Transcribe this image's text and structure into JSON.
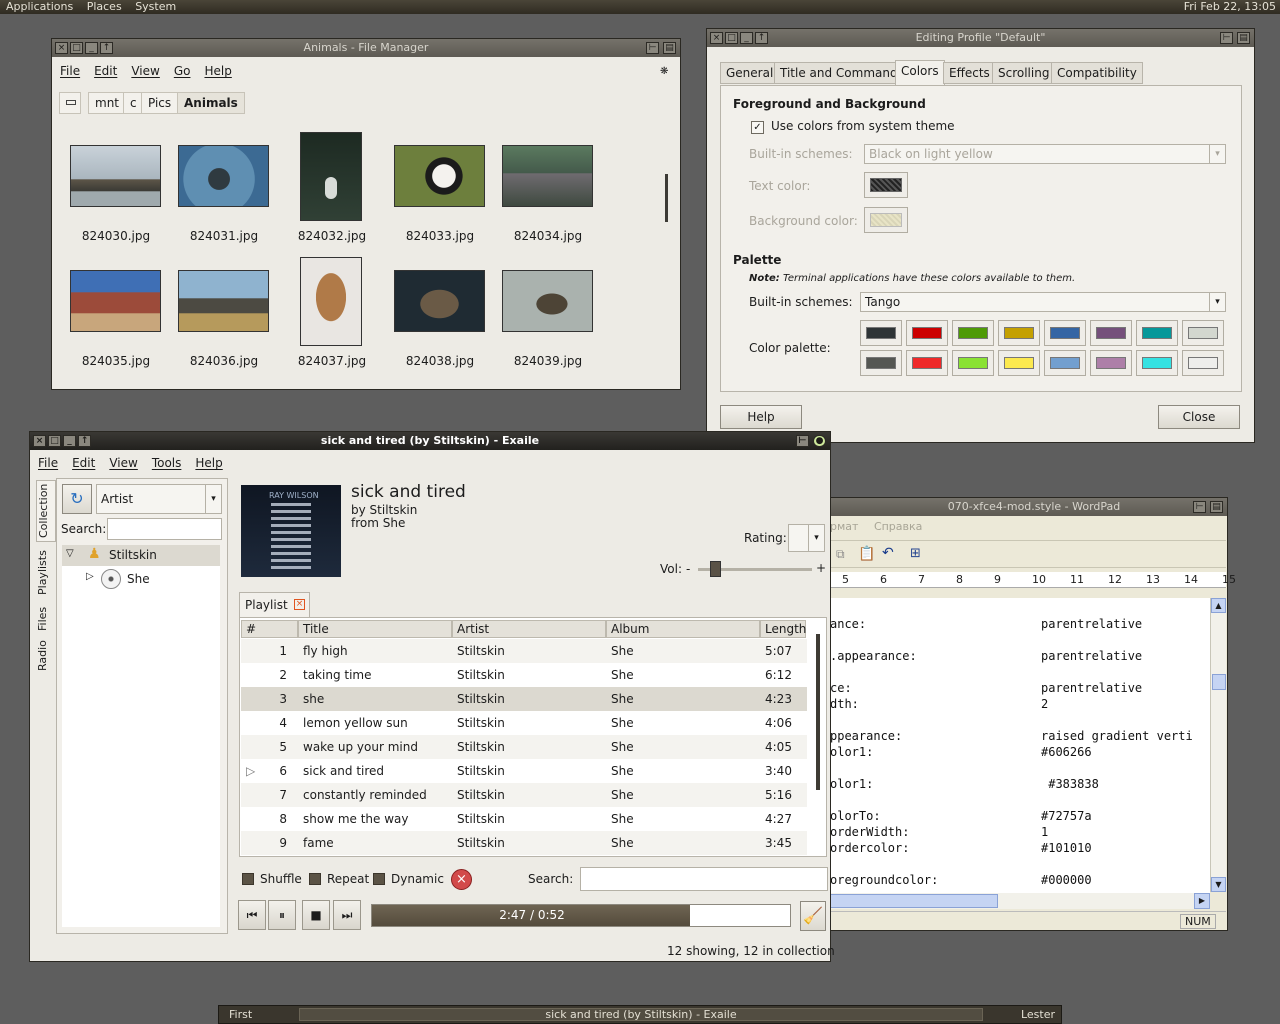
{
  "topbar": {
    "menus": [
      "Applications",
      "Places",
      "System"
    ],
    "clock": "Fri Feb 22, 13:05"
  },
  "file_manager": {
    "title": "Animals - File Manager",
    "menus": [
      "File",
      "Edit",
      "View",
      "Go",
      "Help"
    ],
    "path": [
      "mnt",
      "c",
      "Pics",
      "Animals"
    ],
    "files": [
      "824030.jpg",
      "824031.jpg",
      "824032.jpg",
      "824033.jpg",
      "824034.jpg",
      "824035.jpg",
      "824036.jpg",
      "824037.jpg",
      "824038.jpg",
      "824039.jpg"
    ]
  },
  "profile_dialog": {
    "title": "Editing Profile \"Default\"",
    "tabs": [
      "General",
      "Title and Command",
      "Colors",
      "Effects",
      "Scrolling",
      "Compatibility"
    ],
    "fg_bg_heading": "Foreground and Background",
    "use_system_theme": "Use colors from system theme",
    "builtin_schemes_label": "Built-in schemes:",
    "builtin_schemes_value": "Black on light yellow",
    "text_color_label": "Text color:",
    "background_color_label": "Background color:",
    "palette_heading": "Palette",
    "note_bold": "Note:",
    "note_text": " Terminal applications have these colors available to them.",
    "palette_schemes_label": "Built-in schemes:",
    "palette_schemes_value": "Tango",
    "color_palette_label": "Color palette:",
    "palette_colors": [
      "#2e3436",
      "#cc0000",
      "#4e9a06",
      "#c4a000",
      "#3465a4",
      "#75507b",
      "#06989a",
      "#d3d7cf",
      "#555753",
      "#ef2929",
      "#8ae234",
      "#fce94f",
      "#729fcf",
      "#ad7fa8",
      "#34e2e2",
      "#eeeeec"
    ],
    "help_button": "Help",
    "close_button": "Close"
  },
  "exaile": {
    "title": "sick and tired (by Stiltskin) - Exaile",
    "menus": [
      "File",
      "Edit",
      "View",
      "Tools",
      "Help"
    ],
    "side_tabs": [
      "Collection",
      "Playlists",
      "Files",
      "Radio"
    ],
    "view_mode": "Artist",
    "search_label": "Search:",
    "tree_artist": "Stiltskin",
    "tree_album": "She",
    "album_art_text": "RAY WILSON",
    "track_title": "sick and tired",
    "track_by": "by Stiltskin",
    "track_from": "from She",
    "rating_label": "Rating:",
    "vol_label": "Vol:",
    "vol_minus": "-",
    "vol_plus": "+",
    "playlist_tab": "Playlist",
    "columns": [
      "#",
      "Title",
      "Artist",
      "Album",
      "Length"
    ],
    "tracks": [
      {
        "num": "1",
        "title": "fly high",
        "artist": "Stiltskin",
        "album": "She",
        "length": "5:07"
      },
      {
        "num": "2",
        "title": "taking time",
        "artist": "Stiltskin",
        "album": "She",
        "length": "6:12"
      },
      {
        "num": "3",
        "title": "she",
        "artist": "Stiltskin",
        "album": "She",
        "length": "4:23"
      },
      {
        "num": "4",
        "title": "lemon yellow sun",
        "artist": "Stiltskin",
        "album": "She",
        "length": "4:06"
      },
      {
        "num": "5",
        "title": "wake up your mind",
        "artist": "Stiltskin",
        "album": "She",
        "length": "4:05"
      },
      {
        "num": "6",
        "title": "sick and tired",
        "artist": "Stiltskin",
        "album": "She",
        "length": "3:40"
      },
      {
        "num": "7",
        "title": "constantly reminded",
        "artist": "Stiltskin",
        "album": "She",
        "length": "5:16"
      },
      {
        "num": "8",
        "title": "show me the way",
        "artist": "Stiltskin",
        "album": "She",
        "length": "4:27"
      },
      {
        "num": "9",
        "title": "fame",
        "artist": "Stiltskin",
        "album": "She",
        "length": "3:45"
      }
    ],
    "shuffle": "Shuffle",
    "repeat": "Repeat",
    "dynamic": "Dynamic",
    "search2_label": "Search:",
    "progress_text": "2:47 / 0:52",
    "progress_fraction": 0.76,
    "status": "12 showing, 12 in collection"
  },
  "wordpad": {
    "title": "070-xfce4-mod.style - WordPad",
    "menu_partial": [
      "рмат",
      "Справка"
    ],
    "ruler": [
      "5",
      "6",
      "7",
      "8",
      "9",
      "10",
      "11",
      "12",
      "13",
      "14",
      "15"
    ],
    "lines": [
      {
        "key": "ance:",
        "val": "parentrelative"
      },
      {
        "key": "",
        "val": ""
      },
      {
        "key": ".appearance:",
        "val": "parentrelative"
      },
      {
        "key": "",
        "val": ""
      },
      {
        "key": "ce:",
        "val": "parentrelative"
      },
      {
        "key": "dth:",
        "val": "2"
      },
      {
        "key": "",
        "val": ""
      },
      {
        "key": "ppearance:",
        "val": "raised gradient verti"
      },
      {
        "key": "olor1:",
        "val": "#606266"
      },
      {
        "key": "",
        "val": ""
      },
      {
        "key": "olor1:",
        "val": " #383838"
      },
      {
        "key": "",
        "val": ""
      },
      {
        "key": "olorTo:",
        "val": "#72757a"
      },
      {
        "key": "orderWidth:",
        "val": "1"
      },
      {
        "key": "ordercolor:",
        "val": "#101010"
      },
      {
        "key": "",
        "val": ""
      },
      {
        "key": "oregroundcolor:",
        "val": "#000000"
      }
    ],
    "status_num": "NUM"
  },
  "taskbar": {
    "left": "First",
    "active": "sick and tired (by Stiltskin) - Exaile",
    "right": "Lester"
  }
}
